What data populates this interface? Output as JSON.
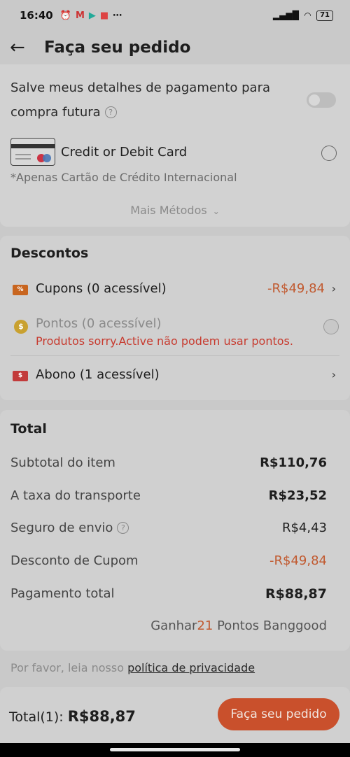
{
  "status_bar": {
    "time": "16:40",
    "notification_icons": [
      "alarm-icon",
      "gmail-icon",
      "play-store-icon",
      "gift-app-icon",
      "more-icon"
    ],
    "battery": "71"
  },
  "header": {
    "title": "Faça seu pedido"
  },
  "payment": {
    "save_details": "Salve meus detalhes de pagamento para compra futura",
    "method_label": "Credit or Debit Card",
    "method_note": "*Apenas Cartão de Crédito  Internacional",
    "more_methods": "Mais Métodos"
  },
  "discounts": {
    "title": "Descontos",
    "coupons": {
      "label": "Cupons (0 acessível)",
      "value": "-R$49,84"
    },
    "points": {
      "label": "Pontos (0 acessível)",
      "warning": "Produtos sorry.Active não podem usar pontos."
    },
    "allowance": {
      "label": "Abono (1 acessível)"
    }
  },
  "total": {
    "title": "Total",
    "rows": [
      {
        "label": "Subtotal do item",
        "value": "R$110,76"
      },
      {
        "label": "A taxa do transporte",
        "value": "R$23,52"
      },
      {
        "label": "Seguro de envio",
        "value": "R$4,43"
      },
      {
        "label": "Desconto de Cupom",
        "value": "-R$49,84"
      },
      {
        "label": "Pagamento total",
        "value": "R$88,87"
      }
    ],
    "earn_prefix": "Ganhar",
    "earn_points": "21",
    "earn_suffix": " Pontos Banggood"
  },
  "privacy": {
    "text": "Por favor, leia nosso ",
    "link": "política de privacidade"
  },
  "footer": {
    "total_label": "Total(1):",
    "total_value": "R$88,87",
    "order_button": "Faça seu pedido"
  },
  "colors": {
    "accent": "#c9502c",
    "discount": "#c15a30",
    "warning": "#c73a2e"
  }
}
